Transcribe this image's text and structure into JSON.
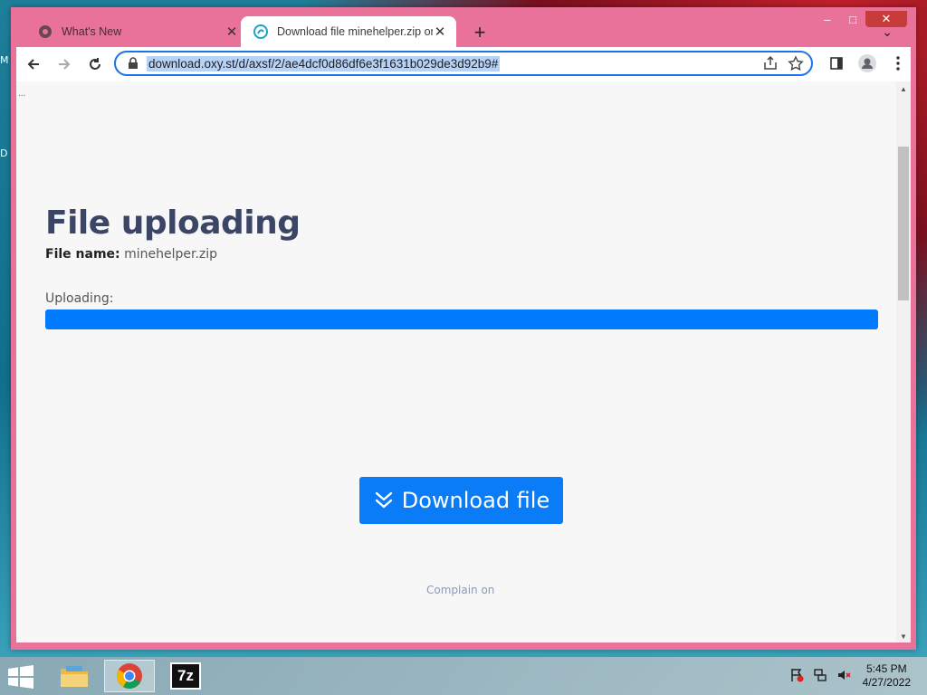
{
  "desktop": {
    "edge_letter_top": "M",
    "edge_letter_mid": "D"
  },
  "browser": {
    "tabs": [
      {
        "title": "What's New",
        "active": false
      },
      {
        "title": "Download file minehelper.zip on",
        "active": true
      }
    ],
    "url": "download.oxy.st/d/axsf/2/ae4dcf0d86df6e3f1631b029de3d92b9#",
    "window_controls": {
      "minimize": "–",
      "maximize": "□",
      "close": "✕"
    }
  },
  "page": {
    "corner_dots": "...",
    "heading": "File uploading",
    "file_name_label": "File name:",
    "file_name": "minehelper.zip",
    "uploading_label": "Uploading:",
    "progress_percent": 100,
    "download_button": "Download file",
    "complain_link": "Complain on"
  },
  "taskbar": {
    "time": "5:45 PM",
    "date": "4/27/2022",
    "apps": [
      "file-explorer",
      "chrome",
      "7zip"
    ],
    "seven_zip_label": "7z"
  },
  "colors": {
    "accent": "#007bff",
    "window_frame": "#e8729a",
    "heading": "#3b4566"
  }
}
